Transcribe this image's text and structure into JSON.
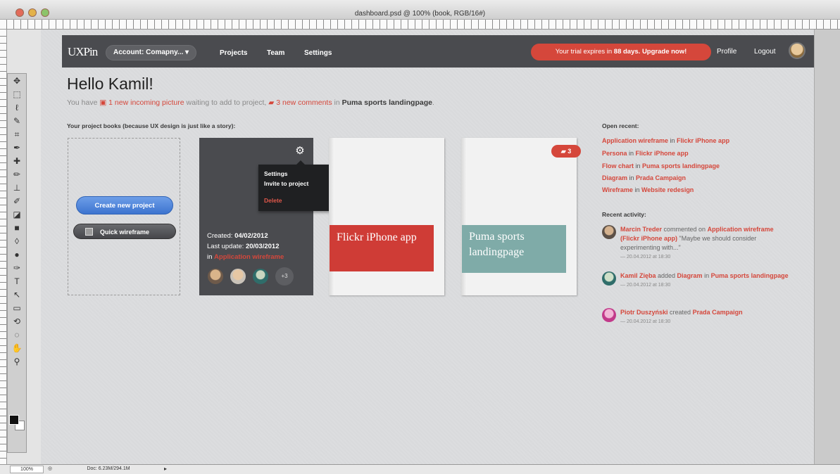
{
  "window": {
    "title": "dashboard.psd @ 100% (book, RGB/16#)",
    "zoom": "100%",
    "doc_info": "Doc: 6.23M/294.1M"
  },
  "colors": {
    "accent_red": "#d5473b",
    "nav_bg": "#4a4b4f",
    "create_blue": "#3d74cf"
  },
  "nav": {
    "logo": "UXPin",
    "account": "Account: Comapny... ▾",
    "links": [
      "Projects",
      "Team",
      "Settings"
    ],
    "trial_prefix": "Your trial expires in ",
    "trial_days": "88 days.",
    "trial_upgrade": "Upgrade now!",
    "profile": "Profile",
    "logout": "Logout"
  },
  "greeting": {
    "title": "Hello Kamil!",
    "you_have": "You have ",
    "incoming": "1 new incoming picture",
    "waiting": " waiting to add to project, ",
    "comments": "3 new comments",
    "in": " in ",
    "project": "Puma sports landingpage",
    "period": "."
  },
  "books": {
    "section_title": "Your project books (because UX design is just like a story):",
    "create_button": "Create new project",
    "quick_button": "Quick wireframe",
    "active": {
      "menu_settings": "Settings",
      "menu_invite": "Invite to project",
      "menu_delete": "Delete",
      "created_label": "Created: ",
      "created": "04/02/2012",
      "updated_label": "Last update: ",
      "updated": "20/03/2012",
      "in_label": "in ",
      "in_project": "Application wireframe",
      "more_members": "+3"
    },
    "book2": {
      "title": "Flickr iPhone app"
    },
    "book3": {
      "title": "Puma sports landingpage",
      "comments": "3"
    }
  },
  "open_recent": {
    "title": "Open recent:",
    "items": [
      {
        "item": "Application wireframe",
        "in": " in ",
        "project": "Flickr iPhone app"
      },
      {
        "item": "Persona",
        "in": " in ",
        "project": "Flickr iPhone app"
      },
      {
        "item": "Flow chart",
        "in": " in ",
        "project": "Puma sports landingpage"
      },
      {
        "item": "Diagram",
        "in": " in ",
        "project": "Prada Campaign"
      },
      {
        "item": "Wireframe",
        "in": " in ",
        "project": "Website redesign"
      }
    ]
  },
  "recent_activity": {
    "title": "Recent activity:",
    "items": [
      {
        "user": "Marcin Treder",
        "action": " commented on ",
        "target": "Application wireframe (Flickr iPhone app)",
        "quote": " \"Maybe we should consider experimenting with...\"",
        "time": "— 20.04.2012 at 18:30"
      },
      {
        "user": "Kamil Zięba",
        "action": " added ",
        "target": "Diagram",
        "in": " in ",
        "project": "Puma sports landingpage",
        "time": "— 20.04.2012 at 18:30"
      },
      {
        "user": "Piotr Duszyński",
        "action": " created ",
        "target": "Prada Campaign",
        "time": "— 20.04.2012 at 18:30"
      }
    ]
  }
}
